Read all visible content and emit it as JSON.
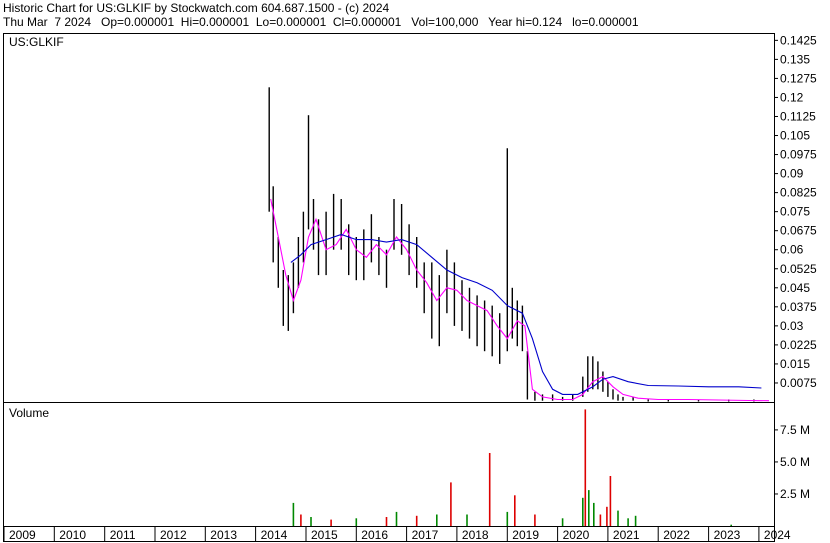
{
  "header": {
    "line1": "Historic Chart for US:GLKIF by Stockwatch.com 604.687.1500 - (c) 2024",
    "line2": "Thu Mar  7 2024   Op=0.000001  Hi=0.000001  Lo=0.000001  Cl=0.000001   Vol=100,000   Year hi=0.124   lo=0.000001"
  },
  "chart_data": [
    {
      "type": "line",
      "title": "US:GLKIF",
      "xlabel": "",
      "ylabel": "",
      "x_ticks": [
        "2009",
        "2010",
        "2011",
        "2012",
        "2013",
        "2014",
        "2015",
        "2016",
        "2017",
        "2018",
        "2019",
        "2020",
        "2021",
        "2022",
        "2023",
        "2024"
      ],
      "ylim": [
        0,
        0.145
      ],
      "y_ticks": [
        "0.0075",
        "0.015",
        "0.0225",
        "0.03",
        "0.0375",
        "0.045",
        "0.0525",
        "0.06",
        "0.0675",
        "0.075",
        "0.0825",
        "0.09",
        "0.0975",
        "0.105",
        "0.1125",
        "0.12",
        "0.1275",
        "0.135",
        "0.1425"
      ],
      "grid": false,
      "series": [
        {
          "name": "",
          "style": "price bars",
          "color": "#000000",
          "x": [
            2014.27,
            2014.35,
            2014.45,
            2014.55,
            2014.65,
            2014.75,
            2014.85,
            2014.95,
            2015.05,
            2015.15,
            2015.25,
            2015.4,
            2015.55,
            2015.7,
            2015.85,
            2016.0,
            2016.15,
            2016.3,
            2016.45,
            2016.6,
            2016.75,
            2016.9,
            2017.05,
            2017.2,
            2017.35,
            2017.5,
            2017.65,
            2017.8,
            2017.95,
            2018.1,
            2018.25,
            2018.4,
            2018.55,
            2018.7,
            2018.85,
            2019.0,
            2019.1,
            2019.2,
            2019.3,
            2019.4,
            2019.55,
            2019.7,
            2019.9,
            2020.1,
            2020.3,
            2020.5,
            2020.6,
            2020.7,
            2020.8,
            2020.9,
            2021.0,
            2021.1,
            2021.2,
            2021.3,
            2021.5,
            2021.8,
            2022.2,
            2022.8,
            2023.4,
            2023.9,
            2024.15
          ],
          "high": [
            0.124,
            0.085,
            0.065,
            0.052,
            0.05,
            0.055,
            0.065,
            0.075,
            0.113,
            0.08,
            0.072,
            0.075,
            0.082,
            0.08,
            0.07,
            0.065,
            0.068,
            0.074,
            0.065,
            0.06,
            0.08,
            0.078,
            0.07,
            0.065,
            0.055,
            0.055,
            0.05,
            0.06,
            0.055,
            0.048,
            0.045,
            0.042,
            0.04,
            0.038,
            0.035,
            0.1,
            0.045,
            0.04,
            0.038,
            0.02,
            0.004,
            0.003,
            0.003,
            0.002,
            0.003,
            0.01,
            0.018,
            0.018,
            0.016,
            0.012,
            0.008,
            0.005,
            0.003,
            0.002,
            0.002,
            0.001,
            0.001,
            0.001,
            0.001,
            0.001,
            1e-06
          ],
          "low": [
            0.075,
            0.055,
            0.045,
            0.03,
            0.028,
            0.035,
            0.045,
            0.055,
            0.068,
            0.06,
            0.05,
            0.05,
            0.06,
            0.06,
            0.05,
            0.048,
            0.048,
            0.055,
            0.05,
            0.045,
            0.06,
            0.058,
            0.05,
            0.045,
            0.035,
            0.025,
            0.022,
            0.035,
            0.03,
            0.028,
            0.025,
            0.022,
            0.02,
            0.018,
            0.015,
            0.02,
            0.025,
            0.022,
            0.02,
            0.001,
            0.0005,
            0.0005,
            0.0005,
            0.0005,
            0.0005,
            0.002,
            0.004,
            0.005,
            0.005,
            0.004,
            0.002,
            0.001,
            0.0005,
            0.0005,
            0.0005,
            0.0002,
            0.0002,
            0.0002,
            0.0002,
            0.0002,
            1e-06
          ]
        },
        {
          "name": "",
          "style": "short moving average",
          "color": "#ff00ff",
          "x": [
            2014.3,
            2014.45,
            2014.6,
            2014.75,
            2014.9,
            2015.05,
            2015.2,
            2015.4,
            2015.6,
            2015.8,
            2016.0,
            2016.2,
            2016.4,
            2016.6,
            2016.8,
            2017.0,
            2017.2,
            2017.4,
            2017.6,
            2017.8,
            2018.0,
            2018.2,
            2018.4,
            2018.6,
            2018.8,
            2019.0,
            2019.2,
            2019.35,
            2019.5,
            2019.7,
            2020.0,
            2020.3,
            2020.5,
            2020.7,
            2020.9,
            2021.1,
            2021.3,
            2021.6,
            2022.0,
            2022.6,
            2023.2,
            2023.8,
            2024.2
          ],
          "values": [
            0.08,
            0.065,
            0.05,
            0.04,
            0.048,
            0.065,
            0.072,
            0.06,
            0.062,
            0.068,
            0.06,
            0.057,
            0.062,
            0.058,
            0.065,
            0.06,
            0.052,
            0.047,
            0.04,
            0.045,
            0.044,
            0.04,
            0.038,
            0.036,
            0.03,
            0.025,
            0.032,
            0.03,
            0.005,
            0.002,
            0.001,
            0.001,
            0.003,
            0.008,
            0.01,
            0.006,
            0.003,
            0.0015,
            0.001,
            0.001,
            0.0008,
            0.0006,
            0.0005
          ]
        },
        {
          "name": "",
          "style": "long moving average",
          "color": "#0000cc",
          "x": [
            2014.7,
            2014.9,
            2015.1,
            2015.4,
            2015.7,
            2016.0,
            2016.3,
            2016.6,
            2016.9,
            2017.2,
            2017.5,
            2017.8,
            2018.1,
            2018.4,
            2018.7,
            2019.0,
            2019.3,
            2019.5,
            2019.7,
            2019.9,
            2020.1,
            2020.4,
            2020.7,
            2020.9,
            2021.1,
            2021.4,
            2021.8,
            2022.4,
            2023.0,
            2023.6,
            2024.05
          ],
          "values": [
            0.055,
            0.058,
            0.062,
            0.064,
            0.066,
            0.064,
            0.064,
            0.063,
            0.064,
            0.062,
            0.057,
            0.052,
            0.049,
            0.047,
            0.044,
            0.038,
            0.035,
            0.025,
            0.012,
            0.005,
            0.003,
            0.003,
            0.006,
            0.009,
            0.01,
            0.008,
            0.0065,
            0.0063,
            0.006,
            0.006,
            0.0055
          ]
        }
      ]
    },
    {
      "type": "bar",
      "title": "Volume",
      "xlabel": "",
      "ylabel": "",
      "ylim": [
        0,
        9600000
      ],
      "y_ticks": [
        "2.5 M",
        "5.0 M",
        "7.5 M"
      ],
      "up_color": "#008800",
      "down_color": "#dd0000",
      "bars": [
        {
          "x": 2014.75,
          "value": 1800000,
          "dir": "up"
        },
        {
          "x": 2014.9,
          "value": 900000,
          "dir": "down"
        },
        {
          "x": 2015.1,
          "value": 700000,
          "dir": "up"
        },
        {
          "x": 2015.5,
          "value": 500000,
          "dir": "down"
        },
        {
          "x": 2016.0,
          "value": 600000,
          "dir": "up"
        },
        {
          "x": 2016.6,
          "value": 700000,
          "dir": "down"
        },
        {
          "x": 2016.8,
          "value": 1100000,
          "dir": "up"
        },
        {
          "x": 2017.2,
          "value": 800000,
          "dir": "down"
        },
        {
          "x": 2017.6,
          "value": 900000,
          "dir": "up"
        },
        {
          "x": 2017.88,
          "value": 3400000,
          "dir": "down"
        },
        {
          "x": 2018.2,
          "value": 900000,
          "dir": "up"
        },
        {
          "x": 2018.65,
          "value": 5700000,
          "dir": "down"
        },
        {
          "x": 2019.0,
          "value": 1100000,
          "dir": "up"
        },
        {
          "x": 2019.15,
          "value": 2400000,
          "dir": "down"
        },
        {
          "x": 2019.55,
          "value": 900000,
          "dir": "down"
        },
        {
          "x": 2020.1,
          "value": 600000,
          "dir": "up"
        },
        {
          "x": 2020.5,
          "value": 2200000,
          "dir": "up"
        },
        {
          "x": 2020.55,
          "value": 9100000,
          "dir": "down"
        },
        {
          "x": 2020.62,
          "value": 2800000,
          "dir": "up"
        },
        {
          "x": 2020.72,
          "value": 1800000,
          "dir": "up"
        },
        {
          "x": 2020.85,
          "value": 900000,
          "dir": "down"
        },
        {
          "x": 2020.98,
          "value": 1500000,
          "dir": "down"
        },
        {
          "x": 2021.05,
          "value": 3900000,
          "dir": "down"
        },
        {
          "x": 2021.2,
          "value": 1200000,
          "dir": "up"
        },
        {
          "x": 2021.4,
          "value": 600000,
          "dir": "up"
        },
        {
          "x": 2021.55,
          "value": 800000,
          "dir": "up"
        },
        {
          "x": 2023.45,
          "value": 100000,
          "dir": "up"
        }
      ]
    }
  ]
}
